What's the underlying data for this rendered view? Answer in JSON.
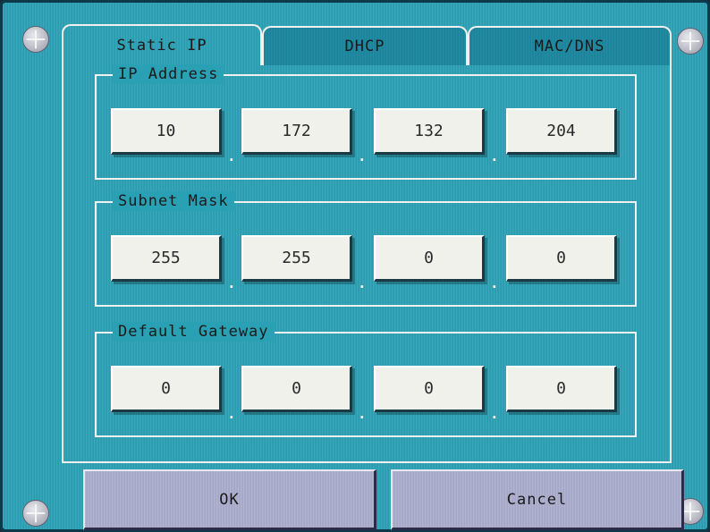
{
  "tabs": [
    {
      "label": "Static IP",
      "active": true
    },
    {
      "label": "DHCP",
      "active": false
    },
    {
      "label": "MAC/DNS",
      "active": false
    }
  ],
  "groups": {
    "ip_address": {
      "title": "IP Address",
      "octets": [
        "10",
        "172",
        "132",
        "204"
      ]
    },
    "subnet_mask": {
      "title": "Subnet Mask",
      "octets": [
        "255",
        "255",
        "0",
        "0"
      ]
    },
    "default_gateway": {
      "title": "Default Gateway",
      "octets": [
        "0",
        "0",
        "0",
        "0"
      ]
    }
  },
  "separator": ".",
  "buttons": {
    "ok": "OK",
    "cancel": "Cancel"
  },
  "colors": {
    "background": "#2aa0b4",
    "field": "#f1f1ec",
    "button": "#a8aacb",
    "border": "#f0f0f0"
  },
  "icons": {
    "corner": "crosshair-icon"
  }
}
